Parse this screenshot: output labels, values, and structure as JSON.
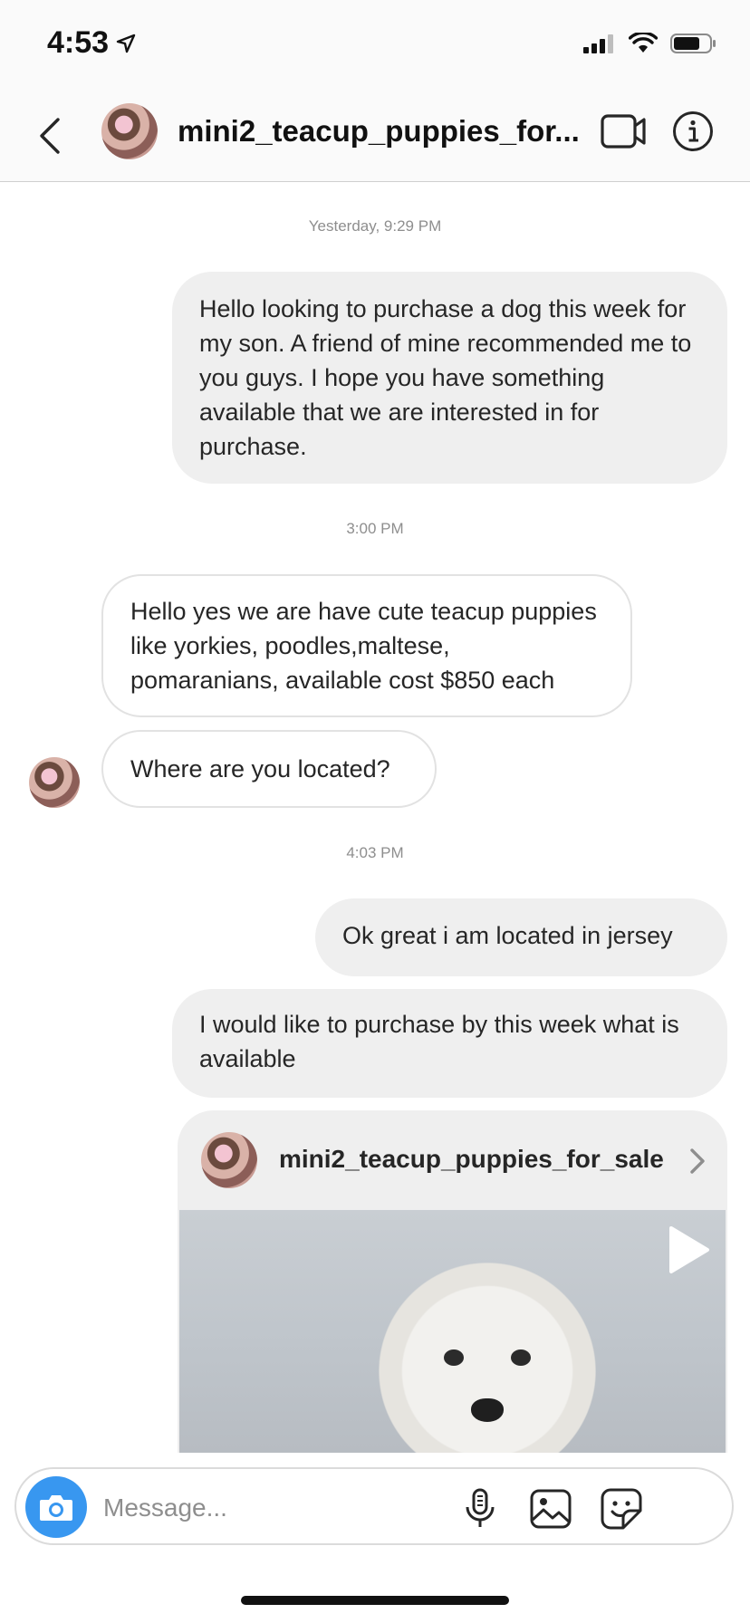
{
  "status_bar": {
    "time": "4:53",
    "location_icon": "location-arrow-icon",
    "signal_icon": "cellular-signal-icon",
    "wifi_icon": "wifi-icon",
    "battery_icon": "battery-icon"
  },
  "header": {
    "back_icon": "chevron-left-icon",
    "username": "mini2_teacup_puppies_for...",
    "video_icon": "video-call-icon",
    "info_icon": "info-icon"
  },
  "messages": [
    {
      "type": "timestamp",
      "text": "Yesterday, 9:29 PM"
    },
    {
      "type": "outgoing",
      "text": "Hello looking to purchase a dog this week for my son. A friend of mine recommended me to you guys. I hope you have something available that we are interested in for purchase."
    },
    {
      "type": "timestamp",
      "text": "3:00 PM"
    },
    {
      "type": "incoming",
      "text": "Hello  yes we are have  cute  teacup puppies  like  yorkies,  poodles,maltese, pomaranians, available cost $850 each"
    },
    {
      "type": "incoming",
      "text": "Where are you located?"
    },
    {
      "type": "timestamp",
      "text": "4:03 PM"
    },
    {
      "type": "outgoing",
      "text": "Ok great i am located in jersey"
    },
    {
      "type": "outgoing",
      "text": "I would like to purchase by this week what is available"
    }
  ],
  "shared_post": {
    "username": "mini2_teacup_puppies_for_sale",
    "chevron_icon": "chevron-right-icon",
    "play_icon": "play-icon"
  },
  "composer": {
    "placeholder": "Message...",
    "camera_icon": "camera-icon",
    "mic_icon": "microphone-icon",
    "gallery_icon": "gallery-icon",
    "sticker_icon": "sticker-icon"
  },
  "colors": {
    "accent": "#3897f0",
    "outgoing_bubble": "#efefef",
    "incoming_border": "#e2e2e2",
    "timestamp": "#8e8e8e"
  }
}
